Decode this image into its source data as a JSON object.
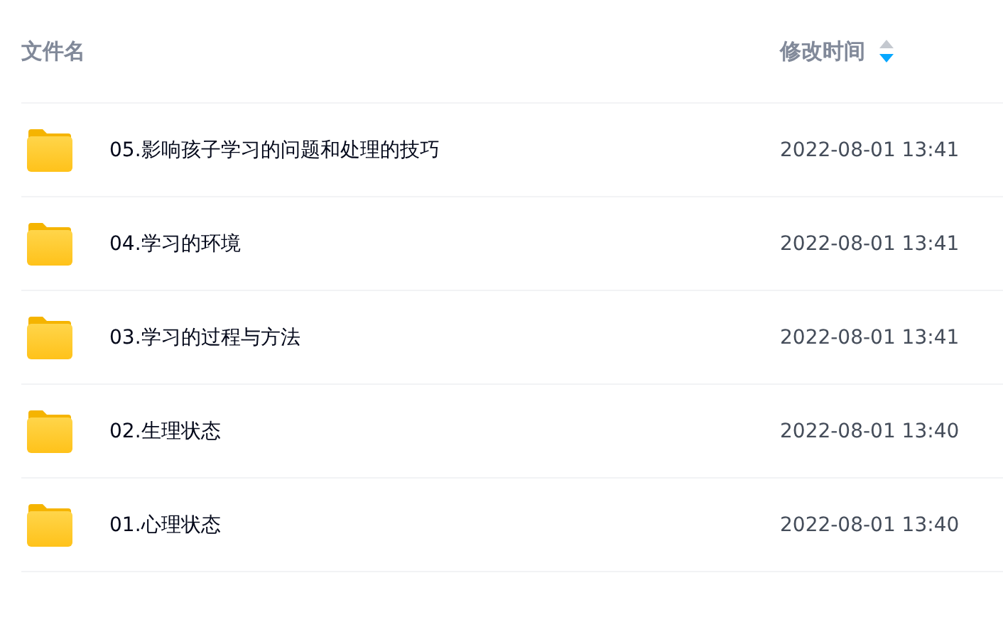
{
  "table": {
    "columns": [
      {
        "label": "文件名"
      },
      {
        "label": "修改时间",
        "sorted": true,
        "descending": true
      }
    ],
    "rows": [
      {
        "name": "05.影响孩子学习的问题和处理的技巧",
        "modified": "2022-08-01 13:41"
      },
      {
        "name": "04.学习的环境",
        "modified": "2022-08-01 13:41"
      },
      {
        "name": "03.学习的过程与方法",
        "modified": "2022-08-01 13:41"
      },
      {
        "name": "02.生理状态",
        "modified": "2022-08-01 13:40"
      },
      {
        "name": "01.心理状态",
        "modified": "2022-08-01 13:40"
      }
    ]
  }
}
